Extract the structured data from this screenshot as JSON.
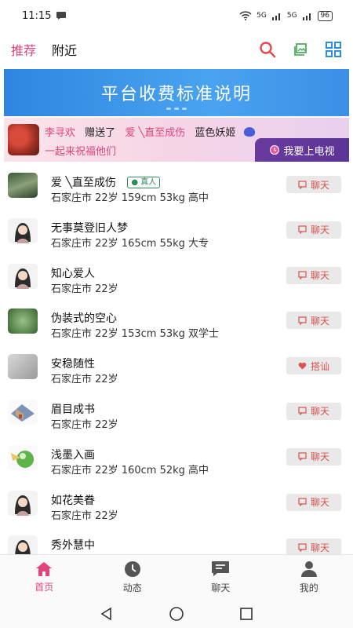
{
  "status": {
    "time": "11:15",
    "battery": "96",
    "net1": "5G",
    "net2": "5G"
  },
  "tabs": [
    {
      "label": "推荐"
    },
    {
      "label": "附近"
    }
  ],
  "banner": {
    "title": "平台收费标准说明"
  },
  "gift": {
    "sender": "李寻欢",
    "verb": "赠送了",
    "receiver": "爱  ╲直至成伤",
    "item": "蓝色妖姬",
    "blessing": "一起来祝福他们",
    "tv_button": "我要上电视"
  },
  "users": [
    {
      "name": "爱  ╲直至成伤",
      "verified": "真人",
      "detail": "石家庄市 22岁 159cm 53kg 高中",
      "action": "聊天",
      "action_icon": "chat-icon"
    },
    {
      "name": "无事莫登旧人梦",
      "detail": "石家庄市 22岁 165cm 55kg 大专",
      "action": "聊天",
      "action_icon": "chat-icon"
    },
    {
      "name": "知心爱人",
      "detail": "石家庄市 22岁",
      "action": "聊天",
      "action_icon": "chat-icon"
    },
    {
      "name": "伪装式的空心",
      "detail": "石家庄市 22岁 153cm 53kg 双学士",
      "action": "聊天",
      "action_icon": "chat-icon"
    },
    {
      "name": "安稳随性",
      "detail": "石家庄市 22岁",
      "action": "搭讪",
      "action_icon": "heart-icon"
    },
    {
      "name": "眉目成书",
      "detail": "石家庄市 22岁",
      "action": "聊天",
      "action_icon": "chat-icon"
    },
    {
      "name": "浅墨入画",
      "detail": "石家庄市 22岁 160cm 52kg 高中",
      "action": "聊天",
      "action_icon": "chat-icon"
    },
    {
      "name": "如花美眷",
      "detail": "石家庄市 22岁",
      "action": "聊天",
      "action_icon": "chat-icon"
    },
    {
      "name": "秀外慧中",
      "detail": "",
      "action": "聊天",
      "action_icon": "chat-icon"
    }
  ],
  "bottom_tabs": [
    {
      "label": "首页"
    },
    {
      "label": "动态"
    },
    {
      "label": "聊天"
    },
    {
      "label": "我的"
    }
  ],
  "colors": {
    "accent": "#e0457b",
    "banner": "#3b8fe6",
    "action_text": "#d9534f"
  }
}
